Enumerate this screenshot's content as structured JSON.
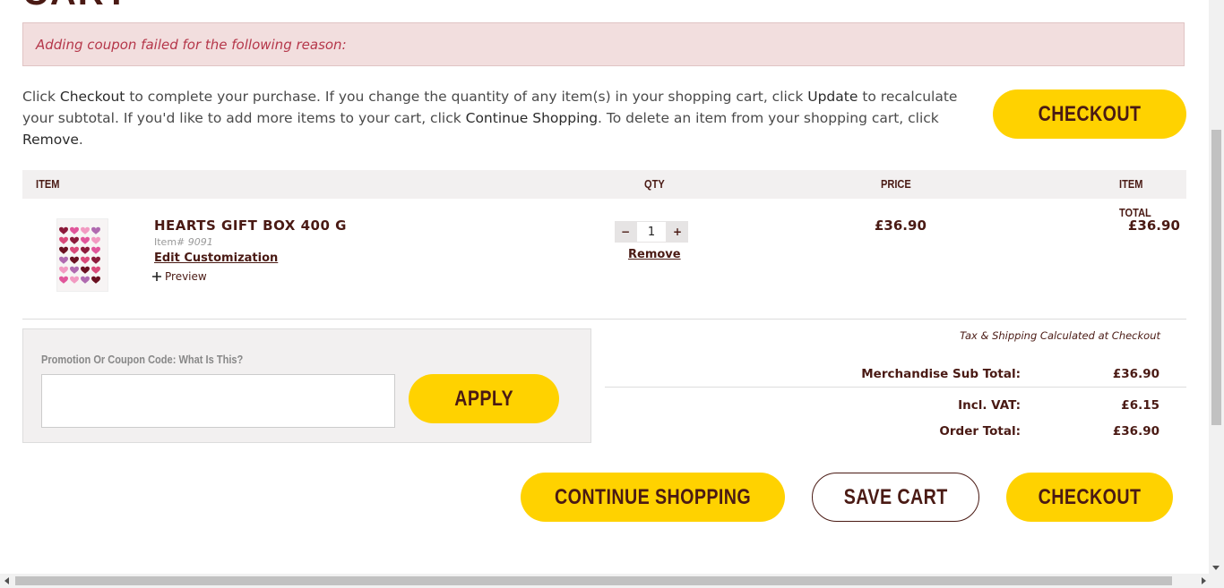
{
  "page": {
    "title": "CART"
  },
  "error": {
    "message": "Adding coupon failed for the following reason:"
  },
  "intro": {
    "p1": "Click ",
    "k1": "Checkout",
    "p2": " to complete your purchase. If you change the quantity of any item(s) in your shopping cart, click ",
    "k2": "Update",
    "p3": " to recalculate your subtotal. If you'd like to add more items to your cart, click ",
    "k3": "Continue Shopping",
    "p4": ". To delete an item from your shopping cart, click ",
    "k4": "Remove",
    "p5": "."
  },
  "buttons": {
    "checkout_top": "CHECKOUT",
    "apply": "APPLY",
    "continue_shopping": "CONTINUE SHOPPING",
    "save_cart": "SAVE CART",
    "checkout_bottom": "CHECKOUT"
  },
  "table": {
    "headers": {
      "item": "ITEM",
      "qty": "QTY",
      "price": "PRICE",
      "item_total": "ITEM TOTAL"
    },
    "rows": [
      {
        "name": "HEARTS GIFT BOX 400 G",
        "item_label": "Item#",
        "item_number": "9091",
        "edit_link": "Edit Customization",
        "preview_label": "Preview",
        "qty_minus": "−",
        "qty": "1",
        "qty_plus": "+",
        "remove": "Remove",
        "price": "£36.90",
        "total": "£36.90"
      }
    ]
  },
  "promo": {
    "label": "Promotion Or Coupon Code: What Is This?",
    "input_value": ""
  },
  "summary": {
    "tax_note": "Tax & Shipping Calculated at Checkout",
    "subtotal_label": "Merchandise Sub Total:",
    "subtotal_value": "£36.90",
    "vat_label": "Incl. VAT:",
    "vat_value": "£6.15",
    "order_total_label": "Order Total:",
    "order_total_value": "£36.90"
  },
  "colors": {
    "brand_brown": "#4a1a14",
    "accent_yellow": "#ffd200",
    "error_bg": "#f2dede",
    "error_text": "#b5374a"
  }
}
